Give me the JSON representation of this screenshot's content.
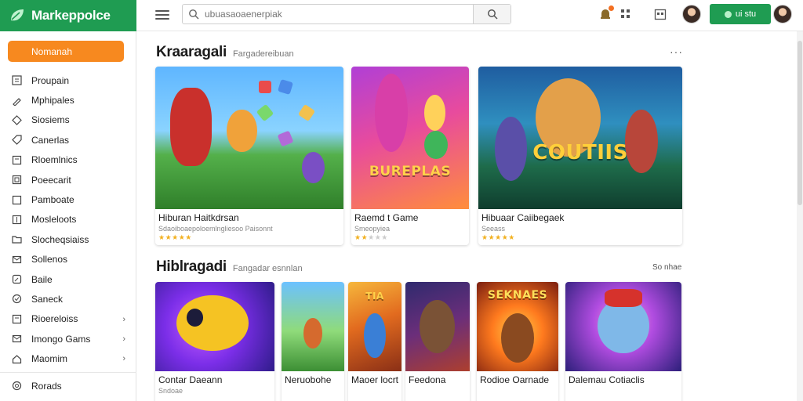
{
  "app": {
    "title": "Markeppolce"
  },
  "topbar": {
    "search_placeholder": "ubuasaoaenerpiak",
    "cta_label": "ui stu"
  },
  "sidebar": {
    "primary_button": "Nomanah",
    "items": [
      {
        "label": "Proupain",
        "icon": "grid-icon"
      },
      {
        "label": "Mphipales",
        "icon": "pencil-icon"
      },
      {
        "label": "Siosiems",
        "icon": "diamond-icon"
      },
      {
        "label": "Canerlas",
        "icon": "tag-icon"
      },
      {
        "label": "Rloemlnics",
        "icon": "box-icon"
      },
      {
        "label": "Poeecarit",
        "icon": "copy-icon"
      },
      {
        "label": "Pamboate",
        "icon": "square-icon"
      },
      {
        "label": "Mosleloots",
        "icon": "bar-icon"
      },
      {
        "label": "Slocheqsiaiss",
        "icon": "folder-icon"
      },
      {
        "label": "Sollenos",
        "icon": "mail-icon"
      },
      {
        "label": "Baile",
        "icon": "edit-icon"
      },
      {
        "label": "Saneck",
        "icon": "check-icon"
      },
      {
        "label": "Rioereloiss",
        "icon": "box-icon",
        "chevron": true
      },
      {
        "label": "Imongo Gams",
        "icon": "mail-icon",
        "chevron": true
      },
      {
        "label": "Maomim",
        "icon": "home-icon",
        "chevron": true
      }
    ],
    "footer_item": {
      "label": "Rorads",
      "icon": "settings-icon"
    }
  },
  "sections": [
    {
      "title": "Kraaragali",
      "subtitle": "Fargadereibuan",
      "more": "···",
      "cards": [
        {
          "name": "Hiburan Haitkdrsan",
          "meta": "Sdaoiboaepoloemlngliesoo Paisonnt",
          "rating": 5,
          "art": "art-a",
          "art_text": ""
        },
        {
          "name": "Raemd t Game",
          "meta": "Smeopyiea",
          "rating": 2,
          "art": "art-b",
          "art_text": "BUREPLAS"
        },
        {
          "name": "Hibuaar Caiibegaek",
          "meta": "Seeass",
          "rating": 5,
          "art": "art-c",
          "art_text": "COUTIIS"
        }
      ]
    },
    {
      "title": "Hiblragadi",
      "subtitle": "Fangadar esnnlan",
      "more_link": "So nhae",
      "cards": [
        {
          "name": "Contar Daeann",
          "meta": "Sndoae",
          "art": "art-d",
          "art_text": ""
        },
        {
          "name": "Neruobohe",
          "meta": "",
          "art": "art-e",
          "art_text": ""
        },
        {
          "name": "Maoer locrt",
          "meta": "",
          "art": "art-f",
          "art_text": "TIA"
        },
        {
          "name": "Feedona",
          "meta": "",
          "art": "art-g",
          "art_text": ""
        },
        {
          "name": "Rodioe Oarnade",
          "meta": "",
          "art": "art-h",
          "art_text": "SEKNAES"
        },
        {
          "name": "Dalemau Cotiaclis",
          "meta": "",
          "art": "art-i",
          "art_text": ""
        }
      ]
    }
  ],
  "colors": {
    "brand_green": "#1f9c52",
    "accent_orange": "#f7891f",
    "star": "#f2b01e"
  }
}
